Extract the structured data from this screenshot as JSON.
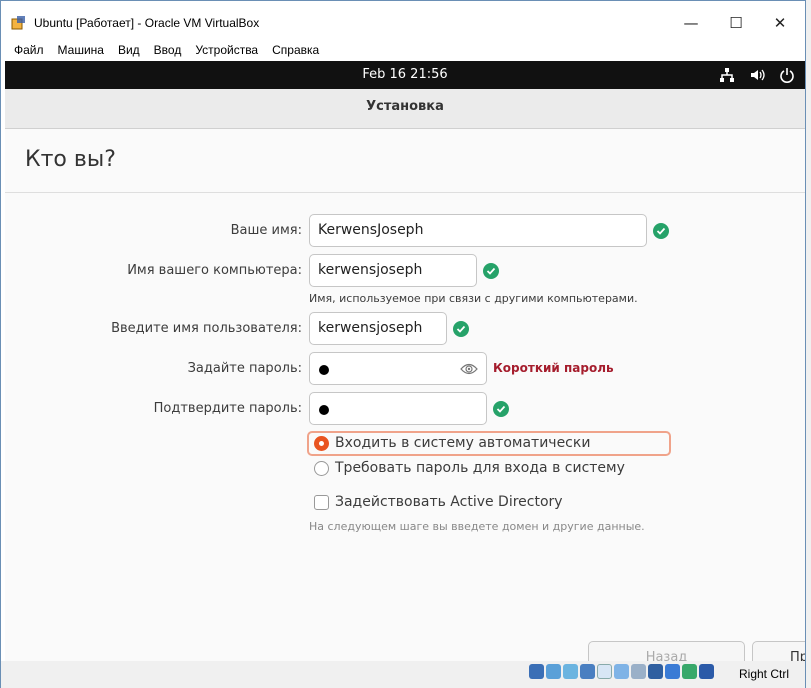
{
  "window": {
    "title": "Ubuntu [Работает] - Oracle VM VirtualBox",
    "controls": {
      "minimize": "—",
      "maximize": "☐",
      "close": "✕"
    }
  },
  "menu": [
    "Файл",
    "Машина",
    "Вид",
    "Ввод",
    "Устройства",
    "Справка"
  ],
  "guest": {
    "clock": "Feb 16  21:56",
    "tray": [
      "network-icon",
      "volume-icon",
      "power-icon"
    ]
  },
  "dialog": {
    "header": "Установка",
    "heading": "Кто вы?",
    "fields": {
      "name": {
        "label": "Ваше имя:",
        "value": "KerwensJoseph"
      },
      "computer": {
        "label": "Имя вашего компьютера:",
        "value": "kerwensjoseph",
        "hint": "Имя, используемое при связи с другими компьютерами."
      },
      "username": {
        "label": "Введите имя пользователя:",
        "value": "kerwensjoseph"
      },
      "password": {
        "label": "Задайте пароль:",
        "warning": "Короткий пароль"
      },
      "confirm": {
        "label": "Подтвердите пароль:"
      }
    },
    "options": {
      "autologin": "Входить в систему автоматически",
      "require_password": "Требовать пароль для входа в систему",
      "active_directory": "Задействовать Active Directory",
      "ad_hint": "На следующем шаге вы введете домен и другие данные."
    },
    "buttons": {
      "back": "Назад",
      "next": "Пр"
    }
  },
  "statusbar": {
    "host_key": "Right Ctrl"
  },
  "colors": {
    "accent": "#e95420",
    "ok": "#26a269",
    "warning": "#a51d2d",
    "titlebar_bg": "#111111"
  }
}
